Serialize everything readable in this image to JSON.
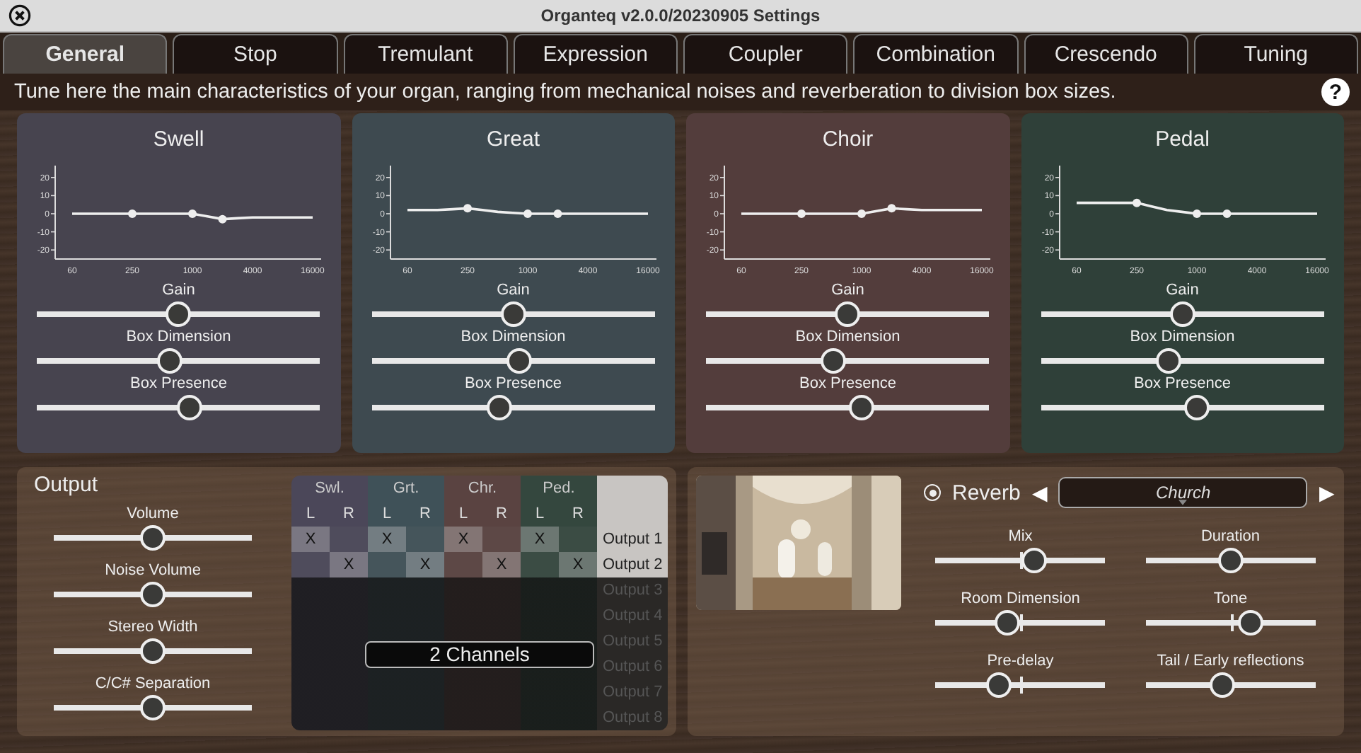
{
  "window": {
    "title": "Organteq v2.0.0/20230905 Settings"
  },
  "tabs": [
    {
      "label": "General",
      "selected": true
    },
    {
      "label": "Stop",
      "selected": false
    },
    {
      "label": "Tremulant",
      "selected": false
    },
    {
      "label": "Expression",
      "selected": false
    },
    {
      "label": "Coupler",
      "selected": false
    },
    {
      "label": "Combination",
      "selected": false
    },
    {
      "label": "Crescendo",
      "selected": false
    },
    {
      "label": "Tuning",
      "selected": false
    }
  ],
  "description": "Tune here the main characteristics of your organ, ranging from mechanical noises and reverberation to division box sizes.",
  "help": "?",
  "divisions": [
    {
      "name": "Swell",
      "color": "#47444f",
      "chart_data": {
        "type": "line",
        "categories": [
          "60",
          null,
          null,
          null,
          "250",
          null,
          null,
          null,
          "1000",
          null,
          null,
          null,
          "4000",
          null,
          null,
          null,
          "16000"
        ],
        "series": [
          {
            "color": "#eeeeee",
            "values": [
              0,
              0,
              0,
              0,
              0,
              0,
              0,
              0,
              0,
              -1.5,
              -3,
              -2.5,
              -2,
              -2,
              -2,
              -2,
              -2
            ]
          }
        ],
        "ylim": [
          -25,
          25
        ],
        "yticks": [
          -20,
          -10,
          0,
          10,
          20
        ]
      },
      "sliders": [
        {
          "label": "Gain",
          "level": 0.5
        },
        {
          "label": "Box Dimension",
          "level": 0.47
        },
        {
          "label": "Box Presence",
          "level": 0.54
        }
      ]
    },
    {
      "name": "Great",
      "color": "#3e4a50",
      "chart_data": {
        "type": "line",
        "categories": [
          "60",
          null,
          null,
          null,
          "250",
          null,
          null,
          null,
          "1000",
          null,
          null,
          null,
          "4000",
          null,
          null,
          null,
          "16000"
        ],
        "series": [
          {
            "color": "#eeeeee",
            "values": [
              2,
              2,
              2,
              2.5,
              3,
              2,
              1,
              0.5,
              0,
              0,
              0,
              0,
              0,
              0,
              0,
              0,
              0
            ]
          }
        ],
        "ylim": [
          -25,
          25
        ],
        "yticks": [
          -20,
          -10,
          0,
          10,
          20
        ]
      },
      "sliders": [
        {
          "label": "Gain",
          "level": 0.5
        },
        {
          "label": "Box Dimension",
          "level": 0.52
        },
        {
          "label": "Box Presence",
          "level": 0.45
        }
      ]
    },
    {
      "name": "Choir",
      "color": "#533d3c",
      "chart_data": {
        "type": "line",
        "categories": [
          "60",
          null,
          null,
          null,
          "250",
          null,
          null,
          null,
          "1000",
          null,
          null,
          null,
          "4000",
          null,
          null,
          null,
          "16000"
        ],
        "series": [
          {
            "color": "#eeeeee",
            "values": [
              0,
              0,
              0,
              0,
              0,
              0,
              0,
              0,
              0,
              1.5,
              3,
              2.5,
              2,
              2,
              2,
              2,
              2
            ]
          }
        ],
        "ylim": [
          -25,
          25
        ],
        "yticks": [
          -20,
          -10,
          0,
          10,
          20
        ]
      },
      "sliders": [
        {
          "label": "Gain",
          "level": 0.5
        },
        {
          "label": "Box Dimension",
          "level": 0.45
        },
        {
          "label": "Box Presence",
          "level": 0.55
        }
      ]
    },
    {
      "name": "Pedal",
      "color": "#2f4039",
      "chart_data": {
        "type": "line",
        "categories": [
          "60",
          null,
          null,
          null,
          "250",
          null,
          null,
          null,
          "1000",
          null,
          null,
          null,
          "4000",
          null,
          null,
          null,
          "16000"
        ],
        "series": [
          {
            "color": "#eeeeee",
            "values": [
              6,
              6,
              6,
              6,
              6,
              4,
              2,
              1,
              0,
              0,
              0,
              0,
              0,
              0,
              0,
              0,
              0
            ]
          }
        ],
        "ylim": [
          -25,
          25
        ],
        "yticks": [
          -20,
          -10,
          0,
          10,
          20
        ]
      },
      "sliders": [
        {
          "label": "Gain",
          "level": 0.5
        },
        {
          "label": "Box Dimension",
          "level": 0.45
        },
        {
          "label": "Box Presence",
          "level": 0.55
        }
      ]
    }
  ],
  "output": {
    "title": "Output",
    "sliders": [
      {
        "label": "Volume",
        "level": 0.5
      },
      {
        "label": "Noise Volume",
        "level": 0.5
      },
      {
        "label": "Stereo Width",
        "level": 0.5
      },
      {
        "label": "C/C# Separation",
        "level": 0.5
      }
    ],
    "matrix": {
      "groups": [
        {
          "label": "Swl.",
          "color": "#4b4759",
          "channels": [
            "L",
            "R"
          ]
        },
        {
          "label": "Grt.",
          "color": "#3f5158",
          "channels": [
            "L",
            "R"
          ]
        },
        {
          "label": "Chr.",
          "color": "#5a4341",
          "channels": [
            "L",
            "R"
          ]
        },
        {
          "label": "Ped.",
          "color": "#34473e",
          "channels": [
            "L",
            "R"
          ]
        }
      ],
      "rows": [
        {
          "label": "Output 1",
          "enabled": true,
          "cells": [
            {
              "checked": true,
              "text": "X"
            },
            {
              "checked": false
            },
            {
              "checked": true,
              "text": "X"
            },
            {
              "checked": false
            },
            {
              "checked": true,
              "text": "X"
            },
            {
              "checked": false
            },
            {
              "checked": true,
              "text": "X"
            },
            {
              "checked": false
            }
          ]
        },
        {
          "label": "Output 2",
          "enabled": true,
          "cells": [
            {
              "checked": false
            },
            {
              "checked": true,
              "text": "X"
            },
            {
              "checked": false
            },
            {
              "checked": true,
              "text": "X"
            },
            {
              "checked": false
            },
            {
              "checked": true,
              "text": "X"
            },
            {
              "checked": false
            },
            {
              "checked": true,
              "text": "X"
            }
          ]
        },
        {
          "label": "Output 3",
          "enabled": false
        },
        {
          "label": "Output 4",
          "enabled": false
        },
        {
          "label": "Output 5",
          "enabled": false
        },
        {
          "label": "Output 6",
          "enabled": false
        },
        {
          "label": "Output 7",
          "enabled": false
        },
        {
          "label": "Output 8",
          "enabled": false
        }
      ]
    },
    "channels_button": "2 Channels"
  },
  "reverb": {
    "enabled": true,
    "label": "Reverb",
    "prev": "◀",
    "next": "▶",
    "preset": "Church",
    "sliders": [
      {
        "label": "Mix",
        "level": 0.58,
        "kind": "marked"
      },
      {
        "label": "Duration",
        "level": 0.5,
        "kind": "plain"
      },
      {
        "label": "Room Dimension",
        "level": 0.42,
        "kind": "marked"
      },
      {
        "label": "Tone",
        "level": 0.62,
        "kind": "marked"
      },
      {
        "label": "Pre-delay",
        "level": 0.37,
        "kind": "marked"
      },
      {
        "label": "Tail / Early reflections",
        "level": 0.45,
        "kind": "plain"
      }
    ]
  }
}
